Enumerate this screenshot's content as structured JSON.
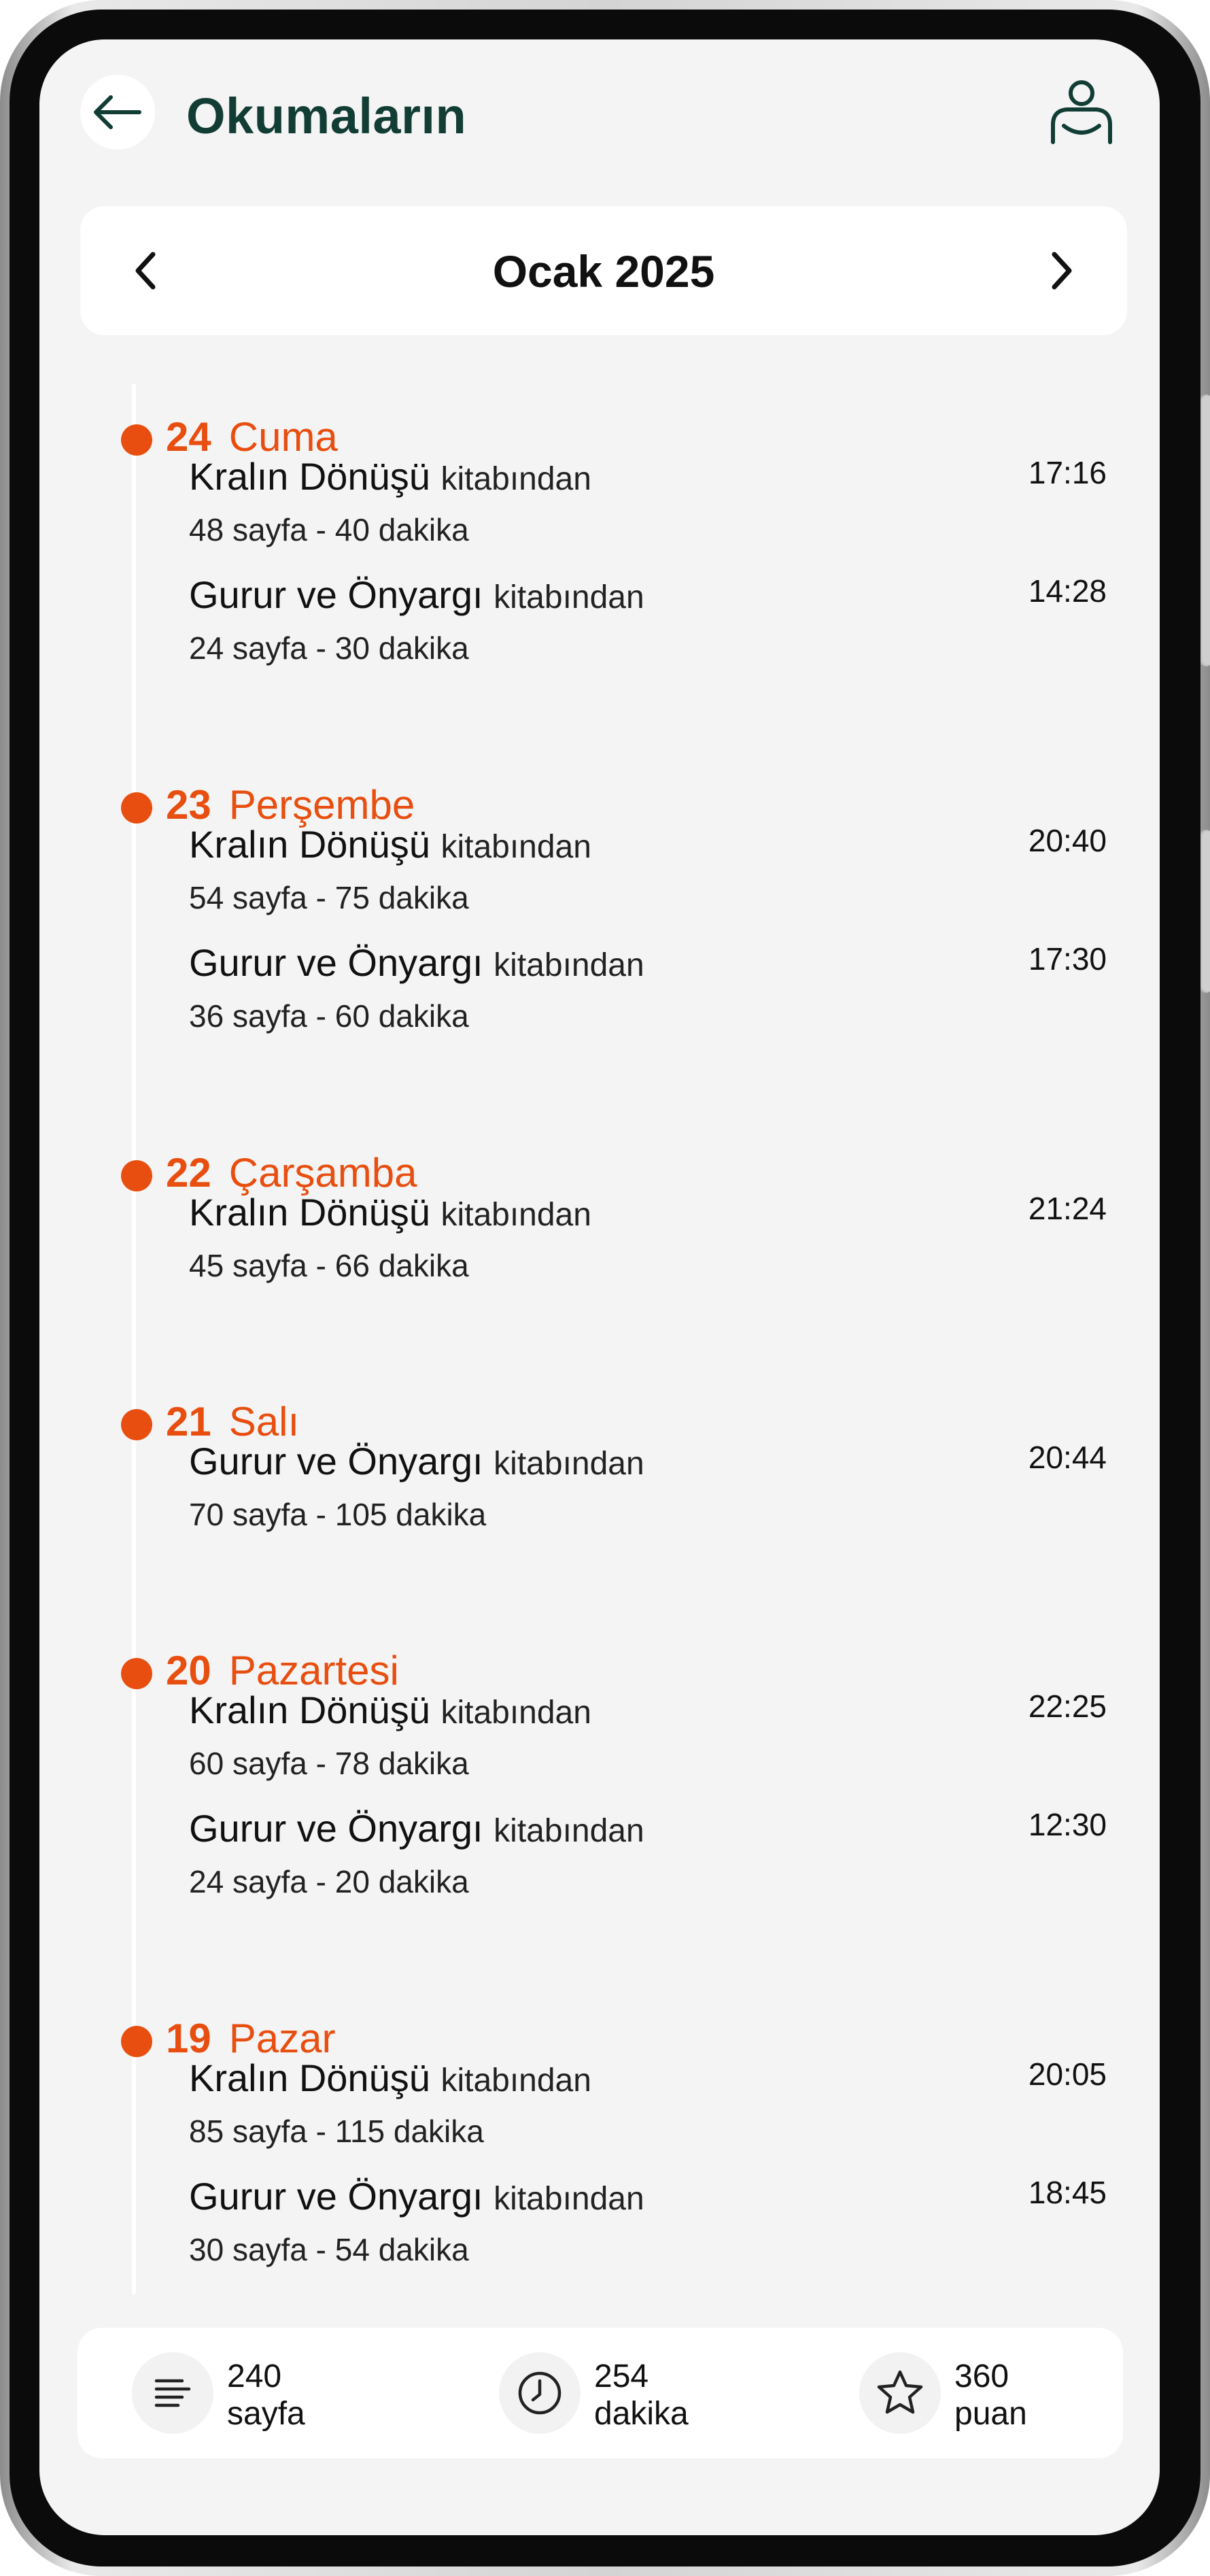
{
  "header": {
    "title": "Okumaların",
    "back_icon": "arrow-left-icon",
    "profile_icon": "user-reading-icon"
  },
  "month_nav": {
    "label": "Ocak 2025",
    "prev_icon": "chevron-left-icon",
    "next_icon": "chevron-right-icon"
  },
  "colors": {
    "accent": "#e84e0f",
    "title": "#123d34",
    "background": "#f4f4f4",
    "card": "#ffffff"
  },
  "days": [
    {
      "num": "24",
      "name": "Cuma",
      "entries": [
        {
          "book": "Kralın Dönüşü",
          "suffix": "kitabından",
          "meta": "48 sayfa - 40 dakika",
          "time": "17:16"
        },
        {
          "book": "Gurur ve Önyargı",
          "suffix": "kitabından",
          "meta": "24 sayfa - 30 dakika",
          "time": "14:28"
        }
      ]
    },
    {
      "num": "23",
      "name": "Perşembe",
      "entries": [
        {
          "book": "Kralın Dönüşü",
          "suffix": "kitabından",
          "meta": "54 sayfa - 75 dakika",
          "time": "20:40"
        },
        {
          "book": "Gurur ve Önyargı",
          "suffix": "kitabından",
          "meta": "36 sayfa - 60 dakika",
          "time": "17:30"
        }
      ]
    },
    {
      "num": "22",
      "name": "Çarşamba",
      "entries": [
        {
          "book": "Kralın Dönüşü",
          "suffix": "kitabından",
          "meta": "45 sayfa - 66 dakika",
          "time": "21:24"
        }
      ]
    },
    {
      "num": "21",
      "name": "Salı",
      "entries": [
        {
          "book": "Gurur ve Önyargı",
          "suffix": "kitabından",
          "meta": "70 sayfa - 105 dakika",
          "time": "20:44"
        }
      ]
    },
    {
      "num": "20",
      "name": "Pazartesi",
      "entries": [
        {
          "book": "Kralın Dönüşü",
          "suffix": "kitabından",
          "meta": "60 sayfa - 78 dakika",
          "time": "22:25"
        },
        {
          "book": "Gurur ve Önyargı",
          "suffix": "kitabından",
          "meta": "24 sayfa - 20 dakika",
          "time": "12:30"
        }
      ]
    },
    {
      "num": "19",
      "name": "Pazar",
      "entries": [
        {
          "book": "Kralın Dönüşü",
          "suffix": "kitabından",
          "meta": "85 sayfa - 115 dakika",
          "time": "20:05"
        },
        {
          "book": "Gurur ve Önyargı",
          "suffix": "kitabından",
          "meta": "30 sayfa - 54 dakika",
          "time": "18:45"
        }
      ]
    }
  ],
  "stats": [
    {
      "icon": "lines-icon",
      "value": "240",
      "unit": "sayfa"
    },
    {
      "icon": "clock-icon",
      "value": "254",
      "unit": "dakika"
    },
    {
      "icon": "star-icon",
      "value": "360",
      "unit": "puan"
    }
  ]
}
